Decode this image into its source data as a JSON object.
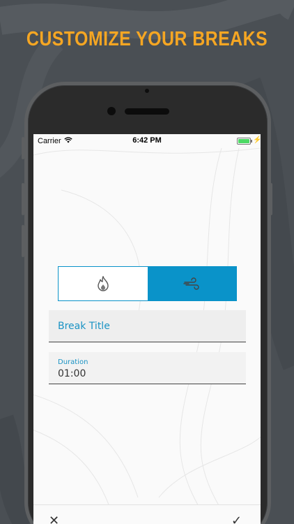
{
  "headline": "CUSTOMIZE YOUR BREAKS",
  "status_bar": {
    "carrier": "Carrier",
    "time": "6:42 PM",
    "battery_level": 1.0
  },
  "break_type": {
    "options": [
      {
        "icon": "flame-icon",
        "selected": false
      },
      {
        "icon": "wind-icon",
        "selected": true
      }
    ]
  },
  "form": {
    "title_placeholder": "Break Title",
    "duration_label": "Duration",
    "duration_value": "01:00"
  },
  "bottom_bar": {
    "close_icon": "close-icon",
    "confirm_icon": "checkmark-icon"
  },
  "colors": {
    "accent": "#0a93c9",
    "headline": "#f5a623",
    "background": "#4a4f54"
  }
}
